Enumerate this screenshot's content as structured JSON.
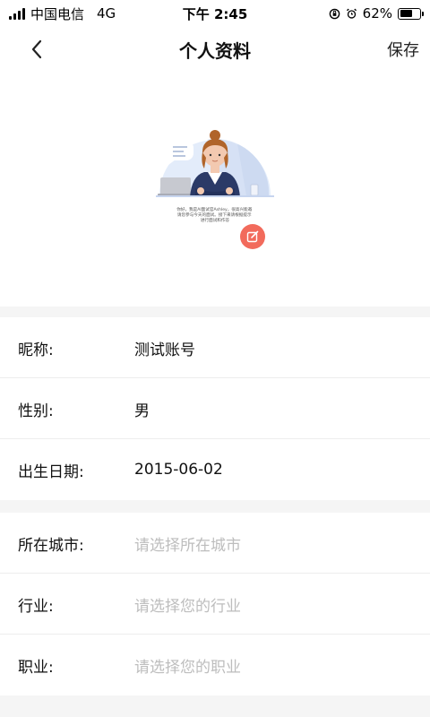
{
  "status_bar": {
    "carrier": "中国电信",
    "network": "4G",
    "time": "下午 2:45",
    "battery_percent": "62%",
    "battery_level": 0.62
  },
  "nav": {
    "title": "个人资料",
    "save_label": "保存"
  },
  "avatar": {
    "icon": "avatar-illustration",
    "edit_icon": "edit-icon",
    "caption": "你好，我是AI面试官Ashley，很高兴能邀请您参与今天的面试。接下来请根据提示进行面试和作答"
  },
  "profile_basic": [
    {
      "label": "昵称:",
      "value": "测试账号",
      "placeholder": false
    },
    {
      "label": "性别:",
      "value": "男",
      "placeholder": false
    },
    {
      "label": "出生日期:",
      "value": "2015-06-02",
      "placeholder": false
    }
  ],
  "profile_work": [
    {
      "label": "所在城市:",
      "value": "请选择所在城市",
      "placeholder": true
    },
    {
      "label": "行业:",
      "value": "请选择您的行业",
      "placeholder": true
    },
    {
      "label": "职业:",
      "value": "请选择您的职业",
      "placeholder": true
    }
  ],
  "colors": {
    "accent": "#f26b5c",
    "placeholder": "#bdbdbd",
    "section_gap": "#f5f5f5"
  }
}
